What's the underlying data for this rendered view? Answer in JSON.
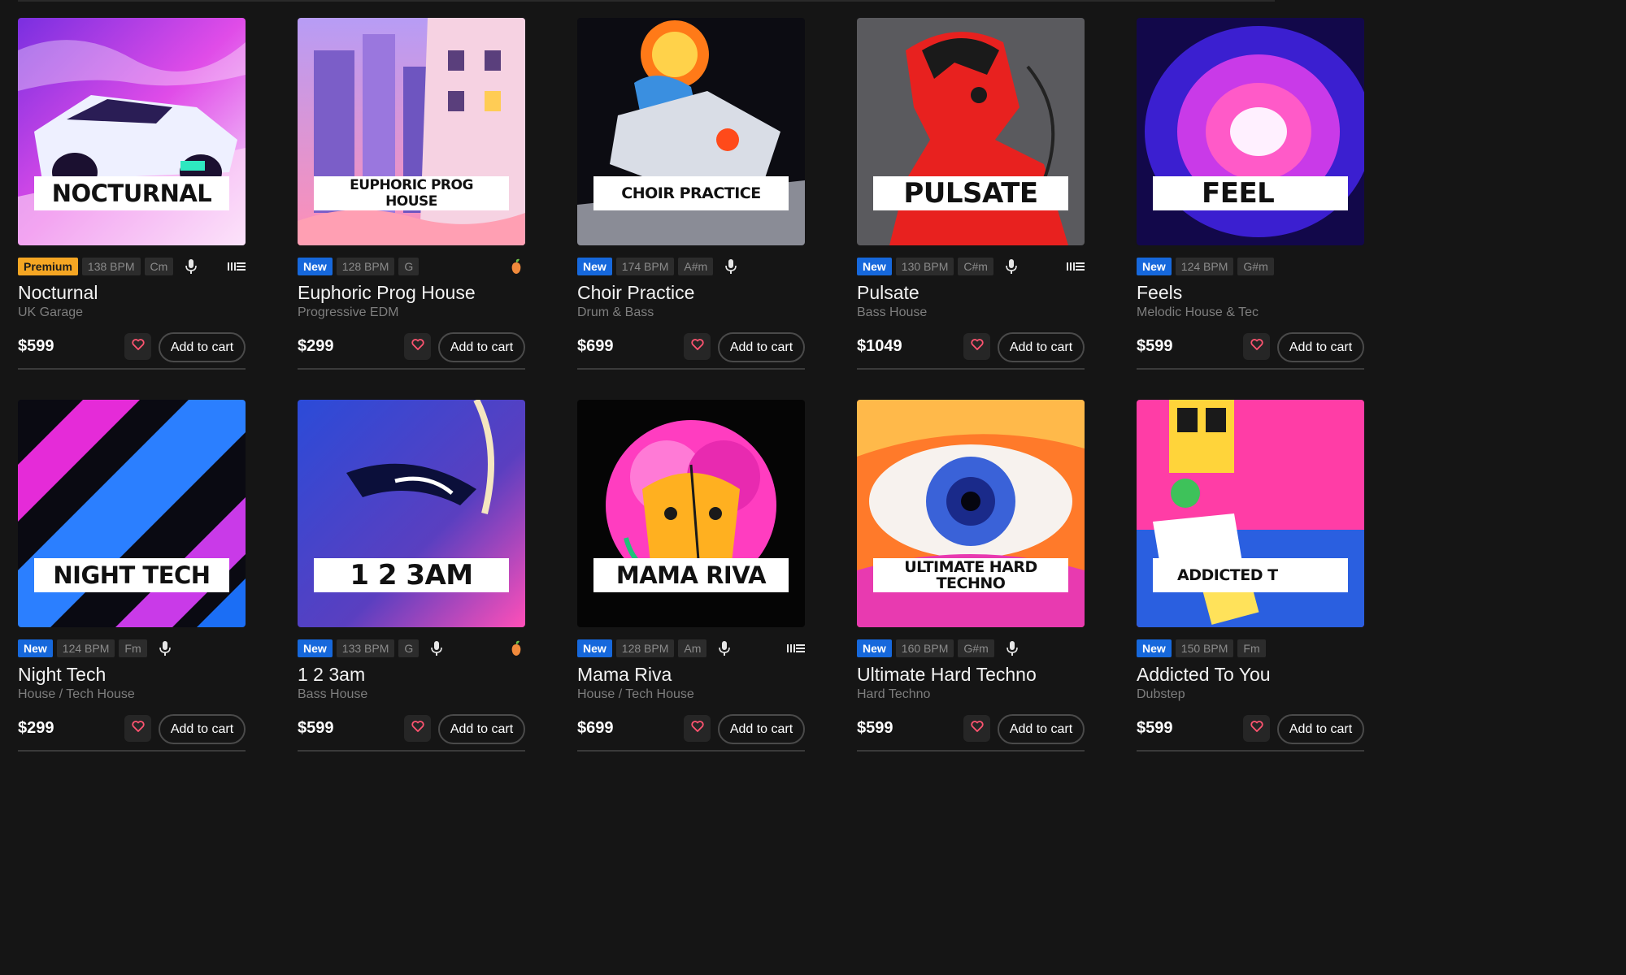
{
  "cart_label": "Add to cart",
  "products": [
    {
      "cover": "NOCTURNAL",
      "badge": "Premium",
      "bpm": "138 BPM",
      "key": "Cm",
      "vocals": true,
      "extra_icon": "stems-icon",
      "title": "Nocturnal",
      "genre": "UK Garage",
      "price": "$599"
    },
    {
      "cover": "EUPHORIC PROG HOUSE",
      "badge": "New",
      "bpm": "128 BPM",
      "key": "G",
      "vocals": false,
      "extra_icon": "fruit-icon",
      "title": "Euphoric Prog House",
      "genre": "Progressive EDM",
      "price": "$299"
    },
    {
      "cover": "CHOIR PRACTICE",
      "badge": "New",
      "bpm": "174 BPM",
      "key": "A#m",
      "vocals": true,
      "extra_icon": "",
      "title": "Choir Practice",
      "genre": "Drum & Bass",
      "price": "$699"
    },
    {
      "cover": "PULSATE",
      "badge": "New",
      "bpm": "130 BPM",
      "key": "C#m",
      "vocals": true,
      "extra_icon": "stems-icon",
      "title": "Pulsate",
      "genre": "Bass House",
      "price": "$1049"
    },
    {
      "cover": "FEEL",
      "badge": "New",
      "bpm": "124 BPM",
      "key": "G#m",
      "vocals": false,
      "extra_icon": "",
      "title": "Feels",
      "genre": "Melodic House & Tec",
      "price": "$599"
    },
    {
      "cover": "NIGHT TECH",
      "badge": "New",
      "bpm": "124 BPM",
      "key": "Fm",
      "vocals": true,
      "extra_icon": "",
      "title": "Night Tech",
      "genre": "House / Tech House",
      "price": "$299"
    },
    {
      "cover": "1 2 3AM",
      "badge": "New",
      "bpm": "133 BPM",
      "key": "G",
      "vocals": true,
      "extra_icon": "fruit-icon",
      "title": "1 2 3am",
      "genre": "Bass House",
      "price": "$599"
    },
    {
      "cover": "MAMA RIVA",
      "badge": "New",
      "bpm": "128 BPM",
      "key": "Am",
      "vocals": true,
      "extra_icon": "stems-icon",
      "title": "Mama Riva",
      "genre": "House / Tech House",
      "price": "$699"
    },
    {
      "cover": "ULTIMATE HARD TECHNO",
      "badge": "New",
      "bpm": "160 BPM",
      "key": "G#m",
      "vocals": true,
      "extra_icon": "",
      "title": "Ultimate Hard Techno",
      "genre": "Hard Techno",
      "price": "$599"
    },
    {
      "cover": "ADDICTED T",
      "badge": "New",
      "bpm": "150 BPM",
      "key": "Fm",
      "vocals": false,
      "extra_icon": "",
      "title": "Addicted To You",
      "genre": "Dubstep",
      "price": "$599"
    }
  ]
}
